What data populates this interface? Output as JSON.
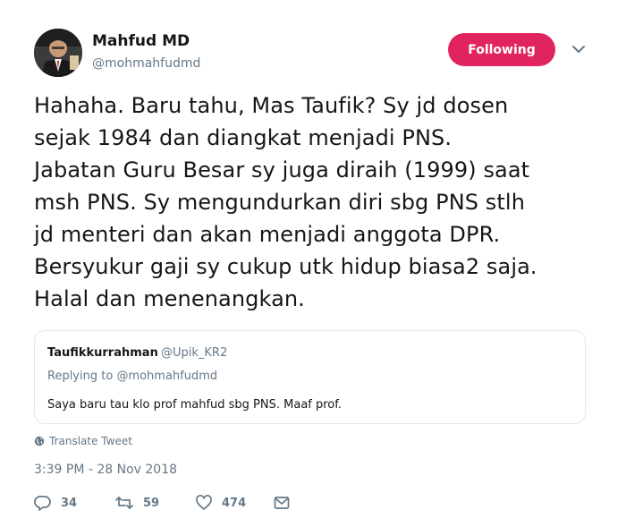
{
  "author": {
    "name": "Mahfud MD",
    "handle": "@mohmahfudmd"
  },
  "follow_button": {
    "label": "Following",
    "color": "#e0245e"
  },
  "tweet": {
    "text": "Hahaha. Baru tahu, Mas Taufik? Sy jd dosen\nsejak 1984 dan diangkat menjadi PNS.\nJabatan Guru Besar sy juga diraih (1999) saat\nmsh PNS. Sy mengundurkan diri sbg PNS stlh\njd menteri dan akan menjadi anggota DPR.\nBersyukur gaji sy cukup utk hidup biasa2 saja.\nHalal dan menenangkan."
  },
  "quoted": {
    "name": "Taufikkurrahman",
    "handle": "@Upik_KR2",
    "replying_prefix": "Replying to",
    "replying_to": "@mohmahfudmd",
    "text": "Saya baru tau klo prof mahfud sbg PNS. Maaf prof."
  },
  "translate_label": "Translate Tweet",
  "timestamp": "3:39 PM - 28 Nov 2018",
  "actions": {
    "replies": "34",
    "retweets": "59",
    "likes": "474"
  },
  "icons": [
    "chevron-down-icon",
    "globe-icon",
    "reply-icon",
    "retweet-icon",
    "heart-icon",
    "message-icon"
  ]
}
